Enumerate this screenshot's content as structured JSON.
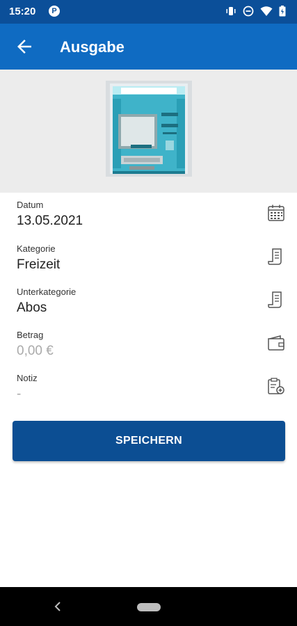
{
  "status_bar": {
    "time": "15:20",
    "app_icon_letter": "P",
    "icons": [
      "vibrate-icon",
      "do-not-disturb-icon",
      "wifi-icon",
      "battery-icon"
    ]
  },
  "header": {
    "title": "Ausgabe",
    "back_icon": "arrow-left-icon",
    "color": "#0f6bc2"
  },
  "hero": {
    "image": "atm-machine-illustration"
  },
  "form": {
    "datum": {
      "label": "Datum",
      "value": "13.05.2021",
      "icon": "calendar-icon"
    },
    "kategorie": {
      "label": "Kategorie",
      "value": "Freizeit",
      "icon": "receipt-icon"
    },
    "unterkategorie": {
      "label": "Unterkategorie",
      "value": "Abos",
      "icon": "receipt-icon"
    },
    "betrag": {
      "label": "Betrag",
      "value": "0,00 €",
      "icon": "wallet-icon"
    },
    "notiz": {
      "label": "Notiz",
      "value": "-",
      "icon": "clipboard-edit-icon"
    }
  },
  "actions": {
    "save_label": "SPEICHERN",
    "color": "#0c4e93"
  },
  "nav": {
    "icons": [
      "back-triangle-icon",
      "home-pill-icon"
    ]
  }
}
